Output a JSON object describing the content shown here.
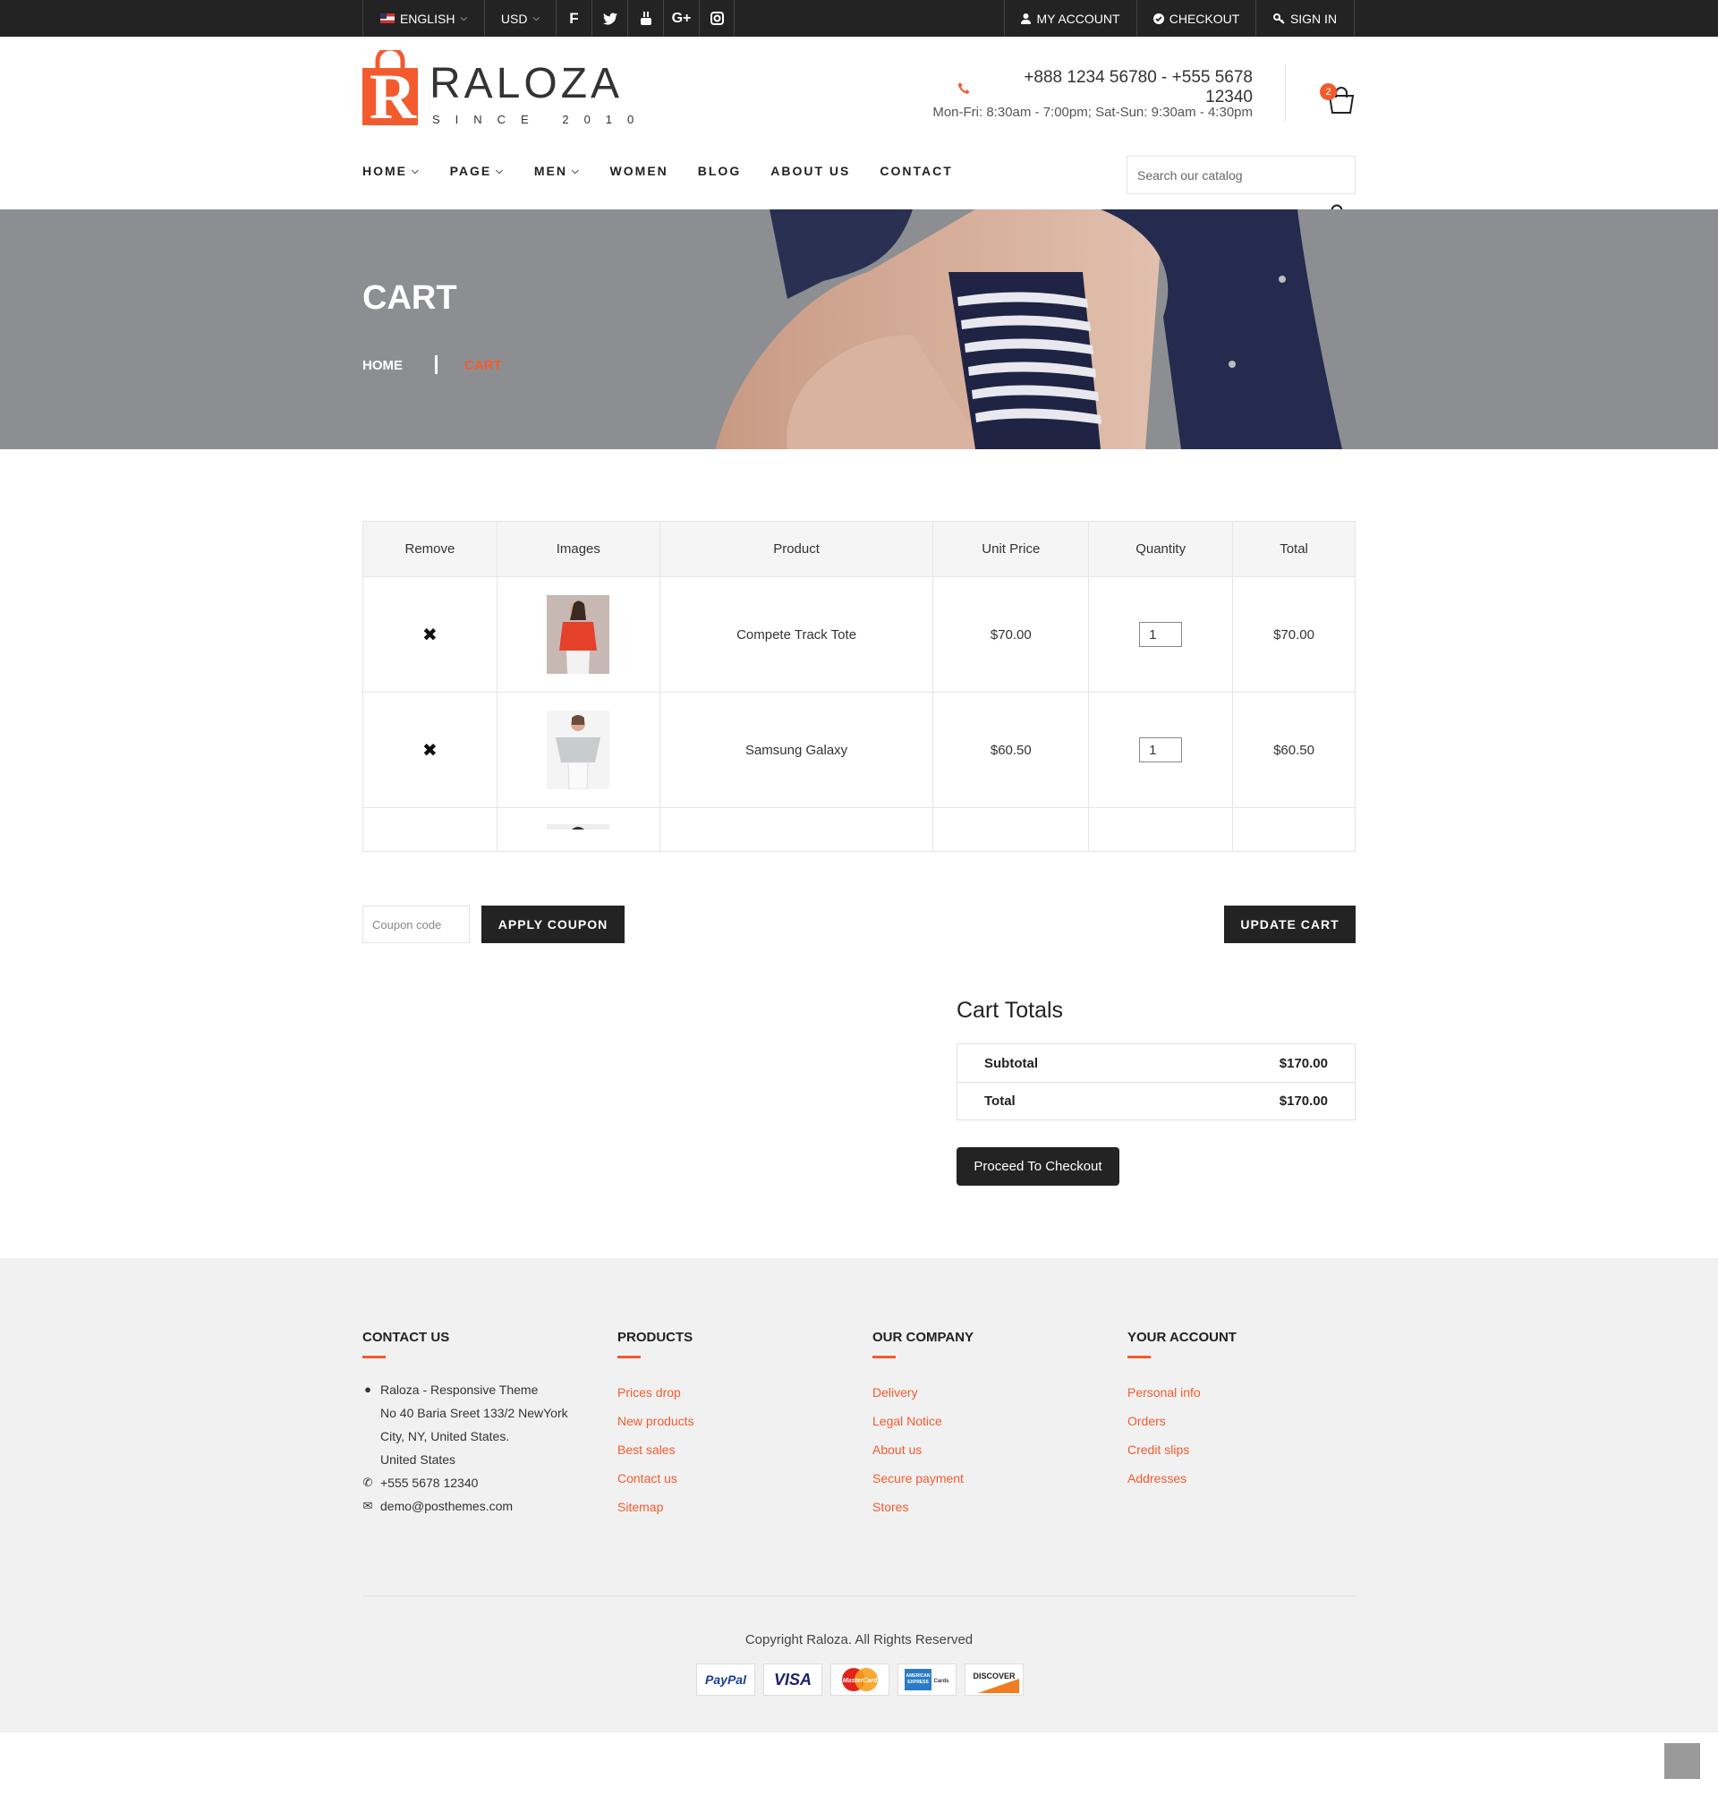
{
  "topbar": {
    "language": "ENGLISH",
    "currency": "USD",
    "social": [
      "facebook-icon",
      "twitter-icon",
      "youtube-icon",
      "google-plus-icon",
      "instagram-icon"
    ],
    "google_plus_label": "G+",
    "my_account": "MY ACCOUNT",
    "checkout": "CHECKOUT",
    "sign_in": "SIGN IN"
  },
  "header": {
    "logo_text": "RALOZA",
    "logo_sub": "SINCE 2010",
    "logo_letter": "R",
    "phone": "+888 1234 56780 - +555 5678 12340",
    "hours": "Mon-Fri: 8:30am - 7:00pm; Sat-Sun: 9:30am - 4:30pm",
    "cart_count": "2"
  },
  "nav": {
    "items": [
      {
        "label": "HOME",
        "dropdown": true
      },
      {
        "label": "PAGE",
        "dropdown": true
      },
      {
        "label": "MEN",
        "dropdown": true
      },
      {
        "label": "WOMEN",
        "dropdown": false
      },
      {
        "label": "BLOG",
        "dropdown": false
      },
      {
        "label": "ABOUT US",
        "dropdown": false
      },
      {
        "label": "CONTACT",
        "dropdown": false
      }
    ],
    "search_placeholder": "Search our catalog"
  },
  "banner": {
    "title": "CART",
    "breadcrumb_home": "HOME",
    "breadcrumb_current": "CART"
  },
  "cart": {
    "headers": [
      "Remove",
      "Images",
      "Product",
      "Unit Price",
      "Quantity",
      "Total"
    ],
    "rows": [
      {
        "product": "Compete Track Tote",
        "unit_price": "$70.00",
        "quantity": "1",
        "total": "$70.00"
      },
      {
        "product": "Samsung Galaxy",
        "unit_price": "$60.50",
        "quantity": "1",
        "total": "$60.50"
      }
    ],
    "coupon_placeholder": "Coupon code",
    "apply_coupon": "APPLY COUPON",
    "update_cart": "UPDATE CART"
  },
  "totals": {
    "title": "Cart Totals",
    "subtotal_label": "Subtotal",
    "subtotal_value": "$170.00",
    "total_label": "Total",
    "total_value": "$170.00",
    "checkout_button": "Proceed To Checkout"
  },
  "footer": {
    "contact": {
      "heading": "CONTACT US",
      "address_lines": [
        "Raloza - Responsive Theme",
        "No 40 Baria Sreet 133/2 NewYork",
        "City, NY, United States.",
        "United States"
      ],
      "phone": "+555 5678 12340",
      "email": "demo@posthemes.com"
    },
    "products": {
      "heading": "PRODUCTS",
      "links": [
        "Prices drop",
        "New products",
        "Best sales",
        "Contact us",
        "Sitemap"
      ]
    },
    "company": {
      "heading": "OUR COMPANY",
      "links": [
        "Delivery",
        "Legal Notice",
        "About us",
        "Secure payment",
        "Stores"
      ]
    },
    "account": {
      "heading": "YOUR ACCOUNT",
      "links": [
        "Personal info",
        "Orders",
        "Credit slips",
        "Addresses"
      ]
    },
    "copyright": "Copyright Raloza. All Rights Reserved",
    "payments": [
      "PayPal",
      "VISA",
      "MasterCard",
      "AmericanExpress",
      "DISCOVER"
    ]
  },
  "colors": {
    "accent": "#f35b2e",
    "dark": "#232323",
    "banner": "#8d8e92"
  }
}
